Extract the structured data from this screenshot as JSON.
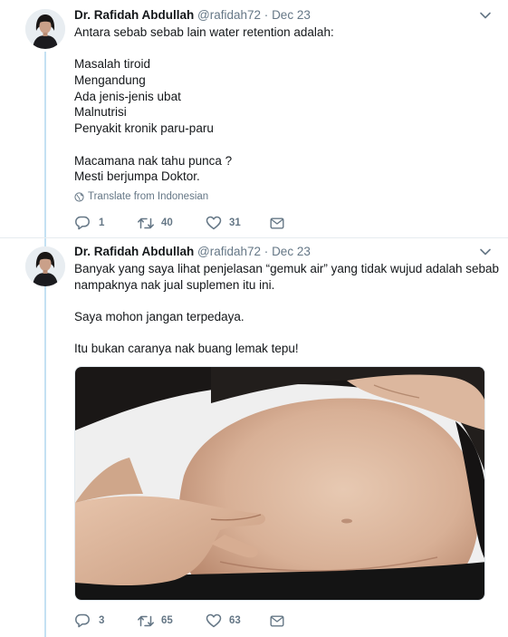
{
  "tweets": [
    {
      "author": {
        "name": "Dr. Rafidah Abdullah",
        "handle": "@rafidah72"
      },
      "separator": "·",
      "date": "Dec 23",
      "text_lines": [
        "Antara sebab sebab lain water retention adalah:",
        "",
        "Masalah tiroid",
        "Mengandung",
        "Ada jenis-jenis ubat",
        "Malnutrisi",
        "Penyakit kronik paru-paru",
        "",
        "Macamana nak tahu punca ?",
        "Mesti berjumpa Doktor."
      ],
      "translate_label": "Translate from Indonesian",
      "actions": {
        "replies": "1",
        "retweets": "40",
        "likes": "31"
      }
    },
    {
      "author": {
        "name": "Dr. Rafidah Abdullah",
        "handle": "@rafidah72"
      },
      "separator": "·",
      "date": "Dec 23",
      "text_lines": [
        "Banyak yang saya lihat penjelasan “gemuk air” yang tidak wujud adalah sebab",
        "nampaknya nak jual suplemen itu ini.",
        "",
        "Saya mohon jangan terpedaya.",
        "",
        "Itu bukan caranya nak buang lemak tepu!"
      ],
      "actions": {
        "replies": "3",
        "retweets": "65",
        "likes": "63"
      }
    }
  ],
  "icons": {
    "reply": "reply-icon",
    "retweet": "retweet-icon",
    "like": "heart-icon",
    "dm": "envelope-icon",
    "menu": "chevron-down-icon",
    "translate": "globe-icon"
  },
  "colors": {
    "name": "#14171a",
    "secondary": "#657786",
    "thread_line": "#c4e1f3",
    "divider": "#e6ecf0"
  }
}
